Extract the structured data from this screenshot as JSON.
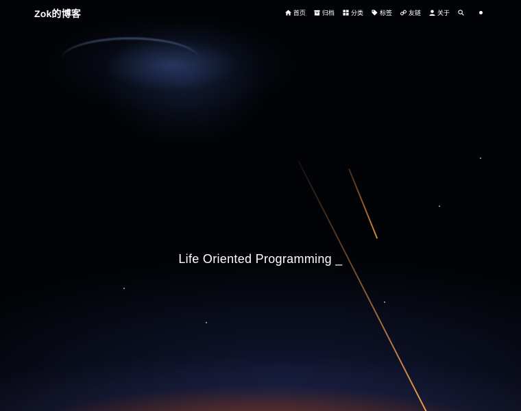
{
  "brand": "Zok的博客",
  "nav": [
    {
      "label": "首页",
      "icon": "home-icon"
    },
    {
      "label": "归档",
      "icon": "archive-icon"
    },
    {
      "label": "分类",
      "icon": "category-icon"
    },
    {
      "label": "标签",
      "icon": "tag-icon"
    },
    {
      "label": "友链",
      "icon": "link-icon"
    },
    {
      "label": "关于",
      "icon": "user-icon"
    }
  ],
  "search_icon": "search-icon",
  "theme_toggle_icon": "dot-icon",
  "hero": {
    "title": "Life Oriented Programming",
    "cursor": "_"
  }
}
